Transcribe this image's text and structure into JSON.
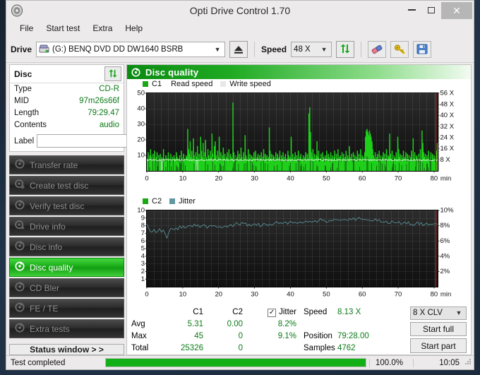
{
  "window": {
    "title": "Opti Drive Control 1.70",
    "app_icon": "disc-icon",
    "minimize": "–",
    "maximize": "□",
    "close": "✕"
  },
  "menu": [
    "File",
    "Start test",
    "Extra",
    "Help"
  ],
  "toolbar": {
    "drive_label": "Drive",
    "drive_value": "(G:)   BENQ DVD DD DW1640 BSRB",
    "eject_icon": "eject-icon",
    "speed_label": "Speed",
    "speed_value": "48 X",
    "refresh_icon": "refresh-icon",
    "erase_icon": "erase-icon",
    "key_icon": "key-icon",
    "save_icon": "save-icon"
  },
  "disc": {
    "title": "Disc",
    "refresh_icon": "refresh-icon",
    "rows": [
      {
        "key": "Type",
        "value": "CD-R"
      },
      {
        "key": "MID",
        "value": "97m26s66f"
      },
      {
        "key": "Length",
        "value": "79:29.47"
      },
      {
        "key": "Contents",
        "value": "audio"
      }
    ],
    "label_key": "Label",
    "label_value": "",
    "label_placeholder": "",
    "label_icon": "cd-icon"
  },
  "nav": {
    "items": [
      {
        "label": "Transfer rate",
        "active": false
      },
      {
        "label": "Create test disc",
        "active": false
      },
      {
        "label": "Verify test disc",
        "active": false
      },
      {
        "label": "Drive info",
        "active": false
      },
      {
        "label": "Disc info",
        "active": false
      },
      {
        "label": "Disc quality",
        "active": true
      },
      {
        "label": "CD Bler",
        "active": false
      },
      {
        "label": "FE / TE",
        "active": false
      },
      {
        "label": "Extra tests",
        "active": false
      }
    ],
    "status_window": "Status window > >"
  },
  "panel": {
    "title": "Disc quality",
    "icon": "disc-quality-icon"
  },
  "stats": {
    "col_c1": "C1",
    "col_c2": "C2",
    "jitter_label": "Jitter",
    "jitter_checked": true,
    "rows": [
      {
        "name": "Avg",
        "c1": "5.31",
        "c2": "0.00",
        "jitter": "8.2%"
      },
      {
        "name": "Max",
        "c1": "45",
        "c2": "0",
        "jitter": "9.1%"
      },
      {
        "name": "Total",
        "c1": "25326",
        "c2": "0",
        "jitter": ""
      }
    ],
    "speed_label": "Speed",
    "speed_value": "8.13 X",
    "position_label": "Position",
    "position_value": "79:28.00",
    "samples_label": "Samples",
    "samples_value": "4762",
    "clv_value": "8 X CLV",
    "start_full": "Start full",
    "start_part": "Start part"
  },
  "statusbar": {
    "text": "Test completed",
    "percent": "100.0%",
    "progress": 100,
    "time": "10:05"
  },
  "colors": {
    "c1_green": "#1fd01b",
    "jitter_teal": "#5f98a0",
    "read_speed_white": "#ffffff",
    "accent_green": "#0c7a18",
    "plot_bg": "#141414",
    "marker_red": "#e01616"
  },
  "chart_data": [
    {
      "type": "area",
      "name": "c1-chart",
      "title": "C1",
      "legend": [
        {
          "label": "C1",
          "color": "#1fd01b",
          "swatch": true
        },
        {
          "label": "Read speed",
          "color": "#ffffff",
          "swatch": false
        },
        {
          "label": "Write speed",
          "color": "#e8e8e8",
          "swatch": true
        }
      ],
      "xlabel": "min",
      "xlim": [
        0,
        81
      ],
      "xticks": [
        0,
        10,
        20,
        30,
        40,
        50,
        60,
        70,
        80
      ],
      "xticklabels": [
        "0",
        "10",
        "20",
        "30",
        "40",
        "50",
        "60",
        "70",
        "80"
      ],
      "ylim": [
        0,
        50
      ],
      "yticks": [
        10,
        20,
        30,
        40,
        50
      ],
      "yticklabels": [
        "10",
        "20",
        "30",
        "40",
        "50"
      ],
      "y2lim": [
        0,
        56
      ],
      "y2ticks": [
        8,
        16,
        24,
        32,
        40,
        48,
        56
      ],
      "y2ticklabels": [
        "8 X",
        "16 X",
        "24 X",
        "32 X",
        "40 X",
        "48 X",
        "56 X"
      ],
      "grid": true,
      "series": [
        {
          "name": "C1",
          "color": "#1fd01b",
          "type": "impulse",
          "values": [
            8,
            12,
            7,
            10,
            14,
            9,
            7,
            11,
            8,
            13,
            6,
            9,
            12,
            7,
            10,
            8,
            11,
            6,
            9,
            7,
            14,
            8,
            6,
            10,
            7,
            9,
            12,
            8,
            5,
            11,
            7,
            9,
            6,
            10,
            8,
            7,
            12,
            9,
            6,
            8,
            10,
            7,
            13,
            9,
            6,
            11,
            8,
            7,
            10,
            9,
            27,
            14,
            11,
            19,
            9,
            13,
            8,
            21,
            10,
            7,
            12,
            9,
            16,
            8,
            11,
            7,
            22,
            13,
            9,
            18,
            8,
            12,
            20,
            9,
            7,
            14,
            10,
            8,
            13,
            9,
            24,
            11,
            8,
            16,
            19,
            10,
            7,
            13,
            9,
            22,
            8,
            12,
            6,
            10,
            15,
            8,
            11,
            7,
            9,
            12,
            8,
            14,
            6,
            11,
            9,
            7,
            44,
            12,
            8,
            10,
            6,
            9,
            13,
            7,
            11,
            8,
            15,
            9,
            6,
            12,
            8,
            23,
            10,
            7,
            9,
            14,
            8,
            11,
            6,
            10,
            9,
            7,
            12,
            8,
            13,
            6,
            9,
            11,
            7,
            10,
            8,
            12,
            6,
            9,
            14,
            7,
            11,
            8,
            10,
            6,
            9,
            28,
            13,
            8,
            11,
            7,
            10,
            9,
            6,
            12,
            8,
            11,
            7,
            9,
            13,
            6,
            10,
            8,
            12,
            7,
            9,
            11,
            6,
            8,
            13,
            10,
            7,
            9,
            22,
            8,
            11,
            6,
            9,
            12,
            7,
            10,
            8,
            13,
            6,
            9,
            11,
            7,
            8,
            10,
            6,
            9,
            12,
            7,
            11,
            8,
            37,
            41,
            25,
            12,
            9,
            14,
            8,
            11,
            7,
            10,
            19,
            9,
            13,
            6,
            8,
            11,
            7,
            12,
            9,
            6,
            10,
            8,
            13,
            7,
            11,
            9,
            6,
            12,
            8,
            10,
            7,
            9,
            13,
            6,
            11,
            8,
            14,
            7,
            9,
            10,
            6,
            12,
            8,
            11,
            7,
            9,
            13,
            6,
            10,
            8,
            16,
            9,
            7,
            11,
            6,
            12,
            8,
            10,
            7,
            9,
            13,
            6,
            11,
            8,
            14,
            7,
            10,
            9,
            6,
            12,
            22,
            26,
            27,
            25,
            23,
            26,
            24,
            22,
            19,
            14,
            10,
            8,
            12,
            7,
            9,
            11,
            6,
            13,
            8,
            10,
            7,
            9,
            12,
            6,
            11,
            8,
            14,
            7,
            10,
            9,
            24,
            11,
            8,
            13,
            6,
            10,
            9,
            7,
            12,
            8,
            22,
            14,
            9,
            11,
            6,
            10,
            8,
            13,
            7,
            9,
            12,
            6,
            11,
            8,
            10,
            7,
            9,
            13,
            6,
            21,
            8,
            12,
            7,
            10,
            9,
            6,
            11,
            8,
            14,
            7,
            26,
            18,
            12,
            9,
            11,
            7,
            10,
            8,
            13,
            6,
            9,
            12,
            7,
            11,
            8,
            10,
            6,
            9,
            13,
            18
          ]
        },
        {
          "name": "Read speed",
          "color": "#ffffff",
          "type": "line",
          "note": "flat trace near 8 X across whole disc"
        }
      ],
      "end_marker": {
        "color": "#e01616",
        "x": 80.5
      }
    },
    {
      "type": "line",
      "name": "c2-jitter-chart",
      "title": "C2 / Jitter",
      "legend": [
        {
          "label": "C2",
          "color": "#1fd01b",
          "swatch": true
        },
        {
          "label": "Jitter",
          "color": "#5f98a0",
          "swatch": true
        }
      ],
      "xlabel": "min",
      "xlim": [
        0,
        81
      ],
      "xticks": [
        0,
        10,
        20,
        30,
        40,
        50,
        60,
        70,
        80
      ],
      "xticklabels": [
        "0",
        "10",
        "20",
        "30",
        "40",
        "50",
        "60",
        "70",
        "80"
      ],
      "ylim": [
        0,
        10
      ],
      "yticks": [
        1,
        2,
        3,
        4,
        5,
        6,
        7,
        8,
        9,
        10
      ],
      "yticklabels": [
        "1",
        "2",
        "3",
        "4",
        "5",
        "6",
        "7",
        "8",
        "9",
        "10"
      ],
      "y2lim": [
        0,
        10
      ],
      "y2ticks": [
        2,
        4,
        6,
        8,
        10
      ],
      "y2ticklabels": [
        "2%",
        "4%",
        "6%",
        "8%",
        "10%"
      ],
      "grid": true,
      "series": [
        {
          "name": "Jitter",
          "color": "#5f98a0",
          "type": "line",
          "values": [
            8.1,
            7.6,
            7.3,
            7.2,
            7.4,
            7.1,
            7.3,
            7.5,
            7.2,
            7.4,
            7.0,
            6.4,
            7.2,
            7.5,
            7.7,
            7.6,
            7.8,
            7.6,
            7.9,
            7.7,
            8.0,
            7.8,
            7.9,
            8.1,
            7.9,
            8.0,
            8.2,
            8.0,
            8.1,
            7.9,
            8.0,
            8.2,
            8.0,
            7.8,
            7.9,
            8.1,
            7.9,
            8.0,
            7.8,
            7.9,
            8.0,
            7.8,
            7.9,
            8.1,
            7.9,
            8.0,
            8.2,
            8.0,
            8.1,
            8.3,
            8.1,
            8.2,
            8.4,
            8.2,
            8.3,
            8.1,
            8.2,
            8.0,
            8.1,
            8.3,
            8.1,
            8.2,
            8.0,
            8.1,
            8.3,
            8.1,
            8.0,
            8.2,
            8.0,
            8.1,
            8.3,
            8.5,
            8.3,
            8.4,
            8.2,
            8.3,
            8.5,
            8.3,
            8.4,
            8.6,
            8.4,
            8.5,
            8.3,
            8.4,
            8.6,
            8.4,
            8.5,
            8.7,
            8.5,
            8.6,
            8.4,
            8.5,
            8.7,
            8.5,
            8.6,
            8.8,
            8.6,
            8.7,
            8.5,
            8.6,
            8.8,
            8.6,
            8.7,
            8.9,
            8.7,
            8.8,
            8.6,
            8.7,
            8.9,
            8.7,
            8.8,
            9.0,
            8.8,
            8.9,
            8.7,
            8.8,
            9.0,
            8.8,
            8.9,
            8.7,
            8.8,
            8.6,
            8.7,
            8.5,
            8.6,
            8.8,
            8.6,
            8.7,
            8.5,
            8.6,
            8.4,
            8.5,
            8.3,
            8.4,
            8.6,
            8.4,
            8.5,
            8.3,
            8.4,
            8.2,
            8.3,
            8.5,
            8.3,
            8.4,
            8.2,
            8.3,
            8.1,
            8.2,
            8.4,
            8.2,
            8.3,
            8.1,
            8.2,
            8.4,
            8.2,
            8.3,
            8.1,
            8.2,
            8.4,
            8.3
          ]
        },
        {
          "name": "C2",
          "color": "#1fd01b",
          "type": "impulse",
          "values": []
        }
      ],
      "end_marker": {
        "color": "#e01616",
        "x": 80.5
      }
    }
  ]
}
